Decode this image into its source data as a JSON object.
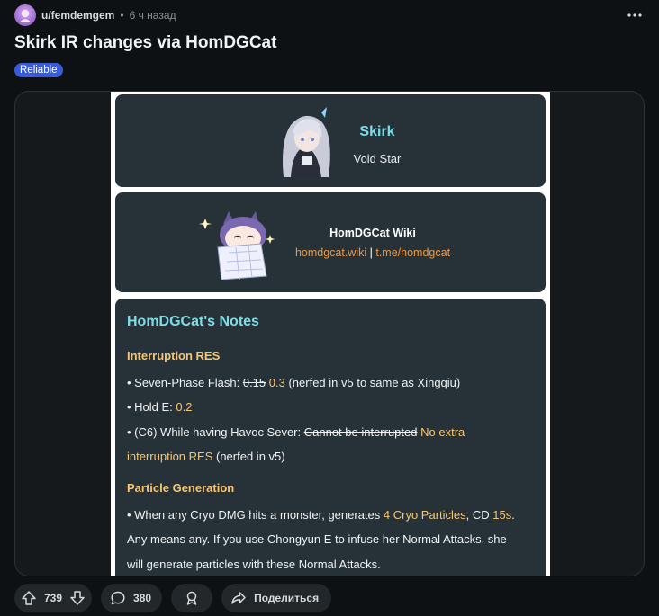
{
  "post": {
    "username": "u/femdemgem",
    "separator": "•",
    "time": "6 ч назад",
    "title": "Skirk IR changes via HomDGCat",
    "flair": "Reliable",
    "more_icon": "more-horizontal-icon"
  },
  "image": {
    "character": {
      "name": "Skirk",
      "subtitle": "Void Star"
    },
    "wiki": {
      "title": "HomDGCat Wiki",
      "link1": "homdgcat.wiki",
      "divider": "|",
      "link2": "t.me/homdgcat"
    },
    "notes": {
      "title": "HomDGCat's Notes",
      "section1": "Interruption RES",
      "s1_line1_prefix": "• Seven-Phase Flash: ",
      "s1_line1_old": "0.15",
      "s1_line1_new": "0.3",
      "s1_line1_suffix": " (nerfed in v5 to same as Xingqiu)",
      "s1_line2_prefix": "• Hold E: ",
      "s1_line2_new": "0.2",
      "s1_line3_prefix": "• (C6) While having Havoc Sever: ",
      "s1_line3_old": "Cannot be interrupted",
      "s1_line3_new_a": "No extra",
      "s1_line3_new_b": "interruption RES",
      "s1_line3_suffix": " (nerfed in v5)",
      "section2": "Particle Generation",
      "s2_line1_prefix": "• When any Cryo DMG hits a monster, generates ",
      "s2_line1_hl1": "4 Cryo Particles",
      "s2_line1_mid": ", CD ",
      "s2_line1_hl2": "15s",
      "s2_line1_end": ".",
      "s2_line2": "Any means any. If you use Chongyun E to infuse her Normal Attacks, she",
      "s2_line3": "will generate particles with these Normal Attacks."
    },
    "colors": {
      "card_bg": "#263238",
      "accent_cyan": "#7fdde8",
      "accent_gold": "#f6c676",
      "link_orange": "#e89a4a"
    }
  },
  "actions": {
    "upvote_icon": "upvote-arrow-icon",
    "score": "739",
    "downvote_icon": "downvote-arrow-icon",
    "comment_icon": "comment-bubble-icon",
    "comments": "380",
    "award_icon": "award-icon",
    "share_icon": "share-arrow-icon",
    "share_label": "Поделиться"
  }
}
